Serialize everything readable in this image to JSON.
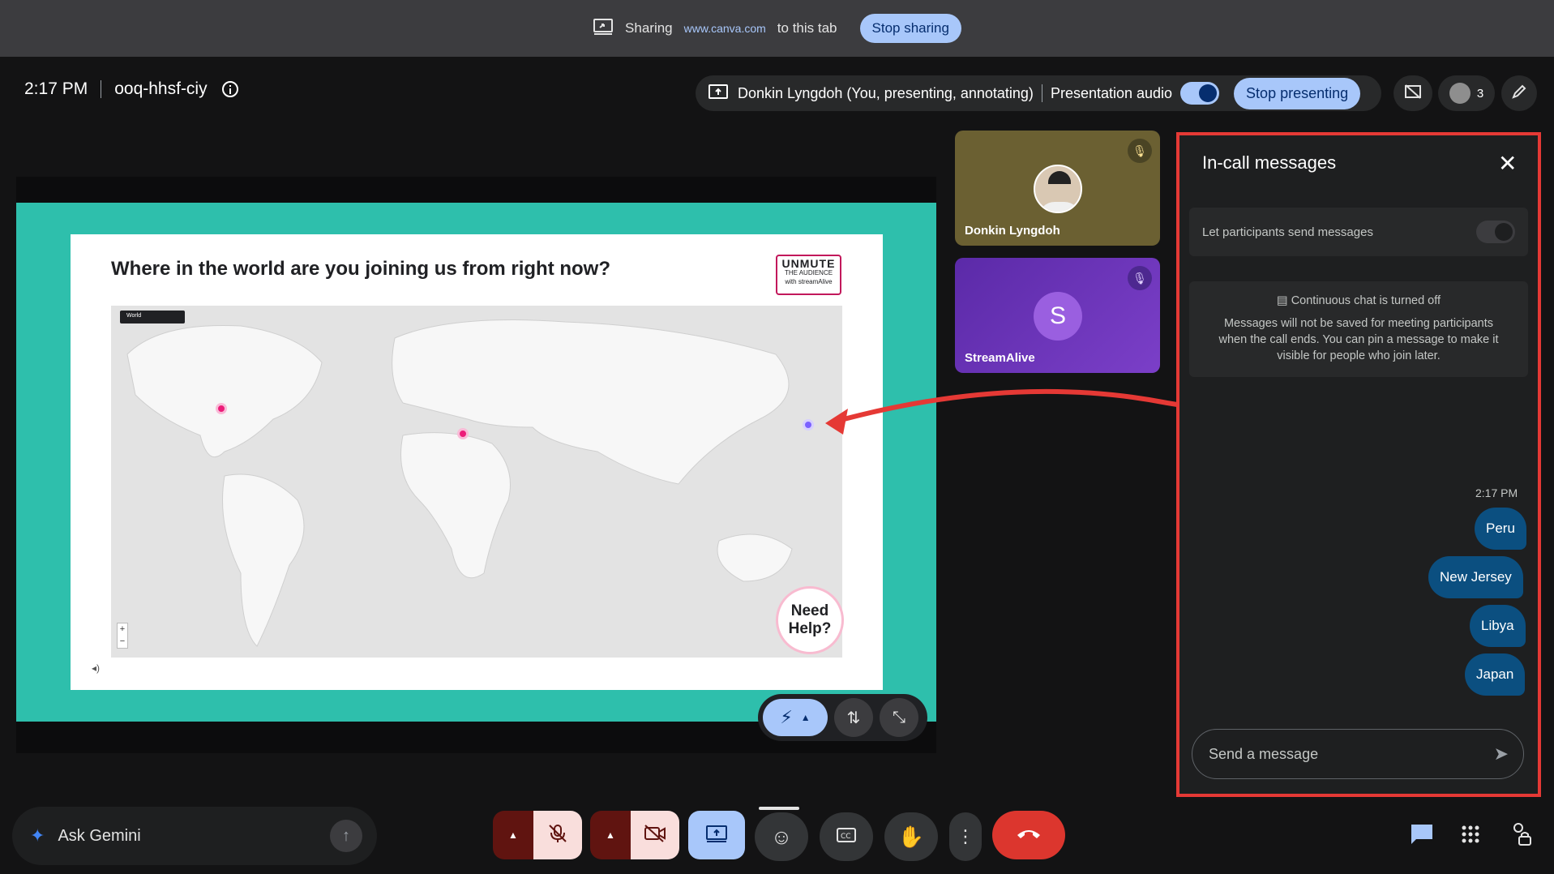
{
  "sharebar": {
    "sharing_label": "Sharing",
    "url": "www.canva.com",
    "suffix": "to this tab",
    "stop_label": "Stop sharing"
  },
  "header": {
    "time": "2:17 PM",
    "meeting_code": "ooq-hhsf-ciy",
    "presenter_text": "Donkin Lyngdoh (You, presenting, annotating)",
    "audio_label": "Presentation audio",
    "stop_presenting_label": "Stop presenting",
    "participant_count": "3"
  },
  "slide": {
    "question": "Where in the world are you joining us from right now?",
    "logo_line1": "UNMUTE",
    "logo_line2": "THE AUDIENCE",
    "logo_line3": "with streamAlive",
    "map_select": "World",
    "need_help": [
      "Need",
      "Help?"
    ]
  },
  "tiles": [
    {
      "name": "Donkin Lyngdoh"
    },
    {
      "name": "StreamAlive",
      "initial": "S"
    }
  ],
  "panel": {
    "title": "In-call messages",
    "permission_label": "Let participants send messages",
    "info_head": "Continuous chat is turned off",
    "info_body": "Messages will not be saved for meeting participants when the call ends. You can pin a message to make it visible for people who join later.",
    "msg_time": "2:17 PM",
    "messages": [
      "Peru",
      "New Jersey",
      "Libya",
      "Japan"
    ],
    "input_placeholder": "Send a message"
  },
  "bottom": {
    "gemini_label": "Ask Gemini"
  },
  "colors": {
    "accent": "#a8c7fa",
    "slide_bg": "#2ebfac",
    "bubble": "#0b4f80",
    "end_call": "#dc362e",
    "annotation": "#e53935"
  }
}
